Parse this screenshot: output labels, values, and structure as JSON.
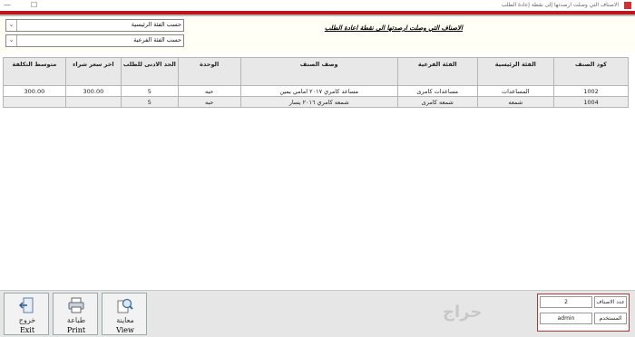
{
  "window": {
    "title": "الاصناف التي وصلت ارصدتها إلى نقطة إعادة الطلب",
    "controls": {
      "minimize": "—",
      "maximize": "☐",
      "close": "✕"
    }
  },
  "filters": {
    "main_category_label": "حسب الفئة الرئيسية",
    "sub_category_label": "حسب الفئة الفرعية",
    "heading": "الاصناف التي وصلت ارصدتها الى نقطة اعادة الطلب"
  },
  "grid": {
    "columns": [
      "كود الصنف",
      "الفئة الرئيسية",
      "الفئة الفرعية",
      "وصف الصنف",
      "الوحدة",
      "الحد الادنى للطلب",
      "اخر سعر شراء",
      "متوسط التكلفة"
    ],
    "rows": [
      {
        "code": "1002",
        "main": "المساعدات",
        "sub": "مساعدات كامرى",
        "desc": "مساعد كامري ٢٠١٧ امامي يمين",
        "unit": "حبه",
        "min": "5",
        "last_price": "300.00",
        "avg_cost": "300.00"
      },
      {
        "code": "1004",
        "main": "شمعه",
        "sub": "شمعه كامرى",
        "desc": "شمعه كامري ٢٠١٦ يسار",
        "unit": "حبه",
        "min": "5",
        "last_price": "",
        "avg_cost": ""
      }
    ]
  },
  "buttons": {
    "exit": {
      "ar": "خروج",
      "en": "Exit"
    },
    "print": {
      "ar": "طباعة",
      "en": "Print"
    },
    "view": {
      "ar": "معاينة",
      "en": "View"
    }
  },
  "summary": {
    "count_label": "عدد الاصناف",
    "count_value": "2",
    "user_label": "المستخدم",
    "user_value": "admin"
  },
  "watermark": "حراج",
  "colors": {
    "accent": "#c0141c"
  }
}
